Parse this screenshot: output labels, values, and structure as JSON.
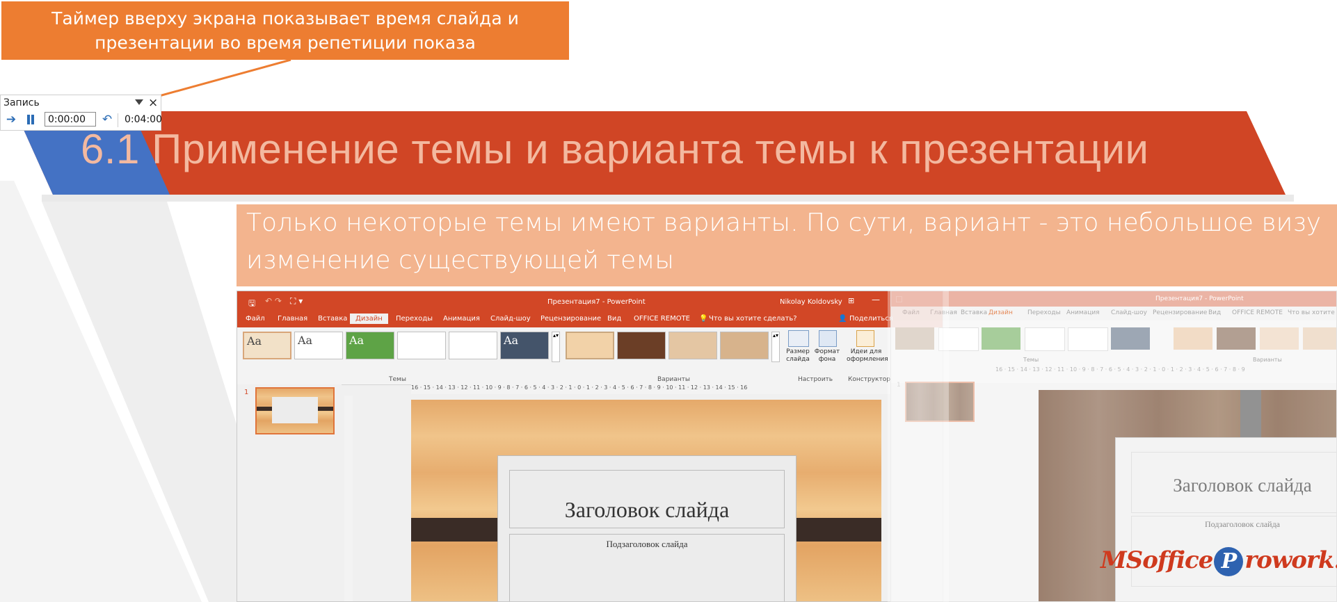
{
  "callout": {
    "line1": "Таймер вверху экрана показывает время слайда и",
    "line2": "презентации во время репетиции показа"
  },
  "recording_toolbar": {
    "title": "Запись",
    "slide_time": "0:00:00",
    "total_time": "0:04:00",
    "close_glyph": "×",
    "next_icon": "arrow-right-icon",
    "pause_icon": "pause-icon",
    "repeat_icon": "undo-icon"
  },
  "slide": {
    "title": "6.1 Применение темы и варианта темы к презентации",
    "subtitle_line1": "Только некоторые темы имеют варианты. По сути, вариант - это небольшое визу",
    "subtitle_line2": "изменение существующей темы"
  },
  "powerpoint": {
    "window_title": "Презентация7 - PowerPoint",
    "user": "Nikolay Koldovsky",
    "tabs": [
      "Файл",
      "Главная",
      "Вставка",
      "Дизайн",
      "Переходы",
      "Анимация",
      "Слайд-шоу",
      "Рецензирование",
      "Вид",
      "OFFICE REMOTE"
    ],
    "active_tab": "Дизайн",
    "tell_me": "Что вы хотите сделать?",
    "share": "Поделиться",
    "theme_label": "Aa",
    "group_themes": "Темы",
    "group_variants": "Варианты",
    "group_customize": "Настроить",
    "group_designer": "Конструктор",
    "btn_slide_size_1": "Размер",
    "btn_slide_size_2": "слайда",
    "btn_format_bg_1": "Формат",
    "btn_format_bg_2": "фона",
    "btn_design_ideas_1": "Идеи для",
    "btn_design_ideas_2": "оформления",
    "slide_number": "1",
    "ruler": "16 · 15 · 14 · 13 · 12 · 11 · 10 · 9 · 8 · 7 · 6 · 5 · 4 · 3 · 2 · 1 · 0 · 1 · 2 · 3 · 4 · 5 · 6 · 7 · 8 · 9 · 10 · 11 · 12 · 13 · 14 · 15 · 16",
    "slide_heading": "Заголовок слайда",
    "slide_subheading": "Подзаголовок слайда"
  },
  "powerpoint2": {
    "window_title": "Презентация7 - PowerPoint",
    "tabs": [
      "Файл",
      "Главная",
      "Вставка",
      "Дизайн",
      "Переходы",
      "Анимация",
      "Слайд-шоу",
      "Рецензирование",
      "Вид",
      "OFFICE REMOTE"
    ],
    "tell_me": "Что вы хотите",
    "group_themes": "Темы",
    "group_variants": "Варианты",
    "slide_number": "1",
    "ruler": "16 · 15 · 14 · 13 · 12 · 11 · 10 · 9 · 8 · 7 · 6 · 5 · 4 · 3 · 2 · 1 · 0 · 1 · 2 · 3 · 4 · 5 · 6 · 7 · 8 · 9",
    "slide_heading": "Заголовок слайда",
    "slide_subheading": "Подзаголовок слайда"
  },
  "logo": {
    "part1": "MSoffice",
    "p": "P",
    "part2": "rowork.com"
  },
  "colors": {
    "accent_orange": "#ed7d31",
    "title_red": "#d04525",
    "title_blue": "#4472c4",
    "subtitle_peach": "#f3b48e",
    "ppt_red": "#d24726"
  }
}
